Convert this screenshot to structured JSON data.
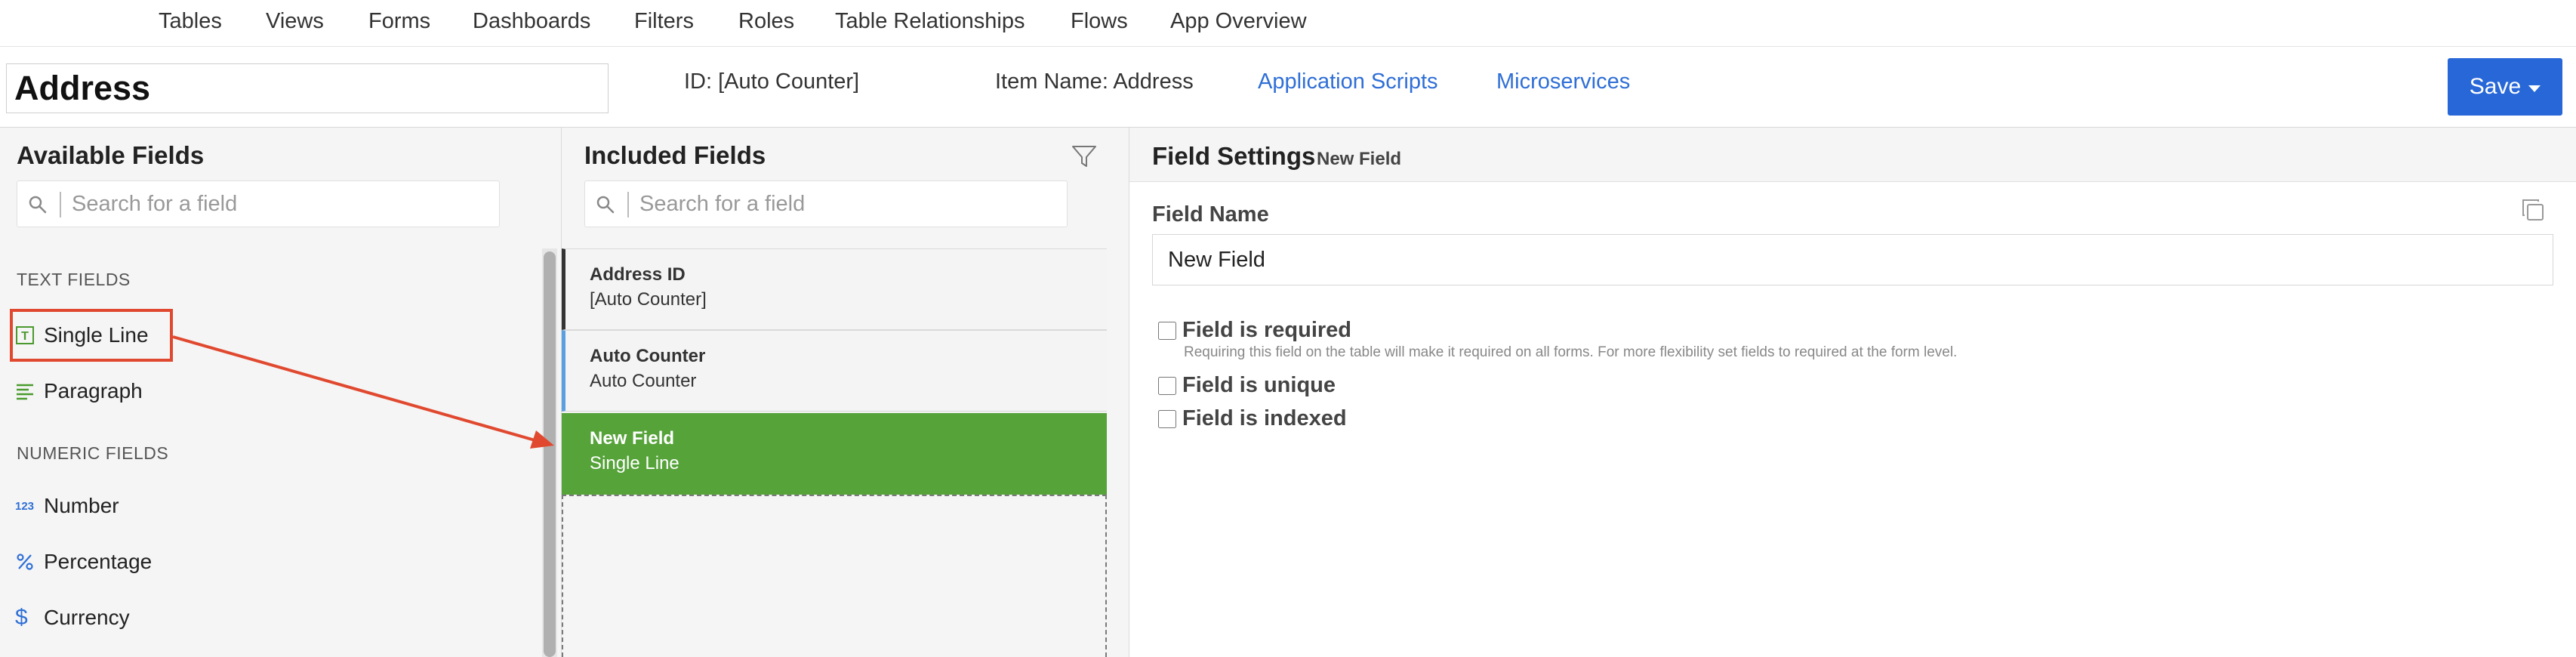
{
  "nav": {
    "items": [
      {
        "label": "Tables",
        "name": "nav-tables",
        "left": 0
      },
      {
        "label": "Views"
      },
      {
        "label": "Forms"
      },
      {
        "label": "Dashboards"
      },
      {
        "label": "Filters"
      },
      {
        "label": "Roles"
      },
      {
        "label": "Table Relationships"
      },
      {
        "label": "Flows"
      },
      {
        "label": "App Overview"
      }
    ]
  },
  "header": {
    "table_name": "Address",
    "id_label": "ID: [Auto Counter]",
    "item_name_label": "Item Name: Address",
    "app_scripts_link": "Application Scripts",
    "microservices_link": "Microservices",
    "save_label": "Save"
  },
  "available": {
    "title": "Available Fields",
    "search_placeholder": "Search for a field",
    "text_section": "TEXT FIELDS",
    "numeric_section": "NUMERIC FIELDS",
    "fields": {
      "single_line": "Single Line",
      "paragraph": "Paragraph",
      "number": "Number",
      "percentage": "Percentage",
      "currency": "Currency"
    },
    "number_icon_text": "123"
  },
  "included": {
    "title": "Included Fields",
    "search_placeholder": "Search for a field",
    "cards": [
      {
        "title": "Address ID",
        "sub": "[Auto Counter]"
      },
      {
        "title": "Auto Counter",
        "sub": "Auto Counter"
      },
      {
        "title": "New Field",
        "sub": "Single Line"
      }
    ]
  },
  "settings": {
    "title": "Field Settings",
    "subtitle": "New Field",
    "field_name_label": "Field Name",
    "field_name_value": "New Field",
    "required_label": "Field is required",
    "required_help": "Requiring this field on the table will make it required on all forms. For more flexibility set fields to required at the form level.",
    "unique_label": "Field is unique",
    "indexed_label": "Field is indexed"
  },
  "colors": {
    "accent_blue": "#2767d8",
    "link_blue": "#2f6fd6",
    "selected_green": "#56a33a",
    "annotation_red": "#e0492f"
  }
}
